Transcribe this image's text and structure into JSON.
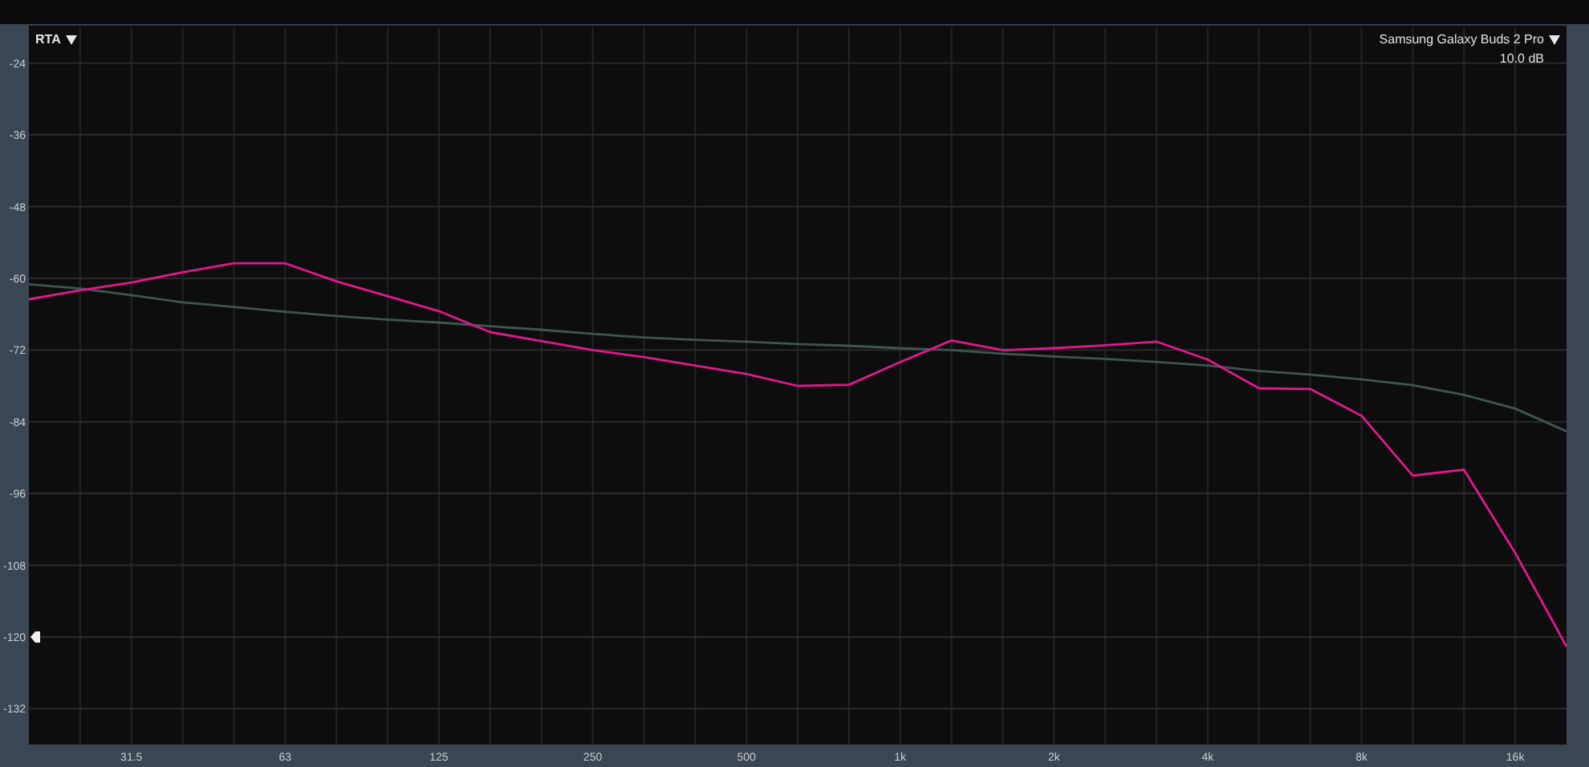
{
  "analyzer": {
    "mode": "RTA",
    "legend": {
      "scale": "10.0 dB"
    },
    "chart_data": {
      "type": "line",
      "grid": true,
      "ylim": [
        -138,
        -18
      ],
      "categories": [
        null,
        null,
        "31.5",
        null,
        null,
        "63",
        null,
        null,
        "125",
        null,
        null,
        "250",
        null,
        null,
        "500",
        null,
        null,
        "1k",
        null,
        null,
        "2k",
        null,
        null,
        "4k",
        null,
        null,
        "8k",
        null,
        null,
        "16k",
        null
      ],
      "series": [
        {
          "name": "Samsung Galaxy Buds 2 Pro",
          "color": "#e0198c",
          "values": [
            -63.5,
            -62,
            -60.7,
            -59,
            -57.5,
            -57.5,
            -60.5,
            -63,
            -65.5,
            -69,
            -70.5,
            -72,
            -73.2,
            -74.6,
            -76,
            -78,
            -77.8,
            -74,
            -70.4,
            -72,
            -71.7,
            -71.2,
            -70.6,
            -73.6,
            -78.4,
            -78.5,
            -83,
            -93,
            -92,
            -106,
            -121.6
          ]
        },
        {
          "color": "#3f5552",
          "values": [
            -61,
            -61.7,
            -62.8,
            -64,
            -64.8,
            -65.6,
            -66.3,
            -66.9,
            -67.4,
            -68,
            -68.6,
            -69.3,
            -69.9,
            -70.3,
            -70.6,
            -71,
            -71.3,
            -71.7,
            -72,
            -72.6,
            -73.1,
            -73.5,
            -74,
            -74.6,
            -75.5,
            -76.1,
            -76.9,
            -77.9,
            -79.5,
            -81.8,
            -85.6
          ]
        }
      ],
      "yticks": [
        -24,
        -36,
        -48,
        -60,
        -72,
        -84,
        -96,
        -108,
        -120,
        -132
      ]
    }
  }
}
